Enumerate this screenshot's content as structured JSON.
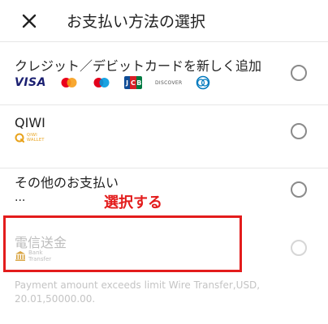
{
  "header": {
    "title": "お支払い方法の選択",
    "close_icon": "close-icon"
  },
  "payment_options": {
    "card": {
      "label": "クレジット／デビットカードを新しく追加",
      "brands": {
        "visa": "VISA",
        "jcb": [
          "J",
          "C",
          "B"
        ],
        "discover": "DISCOVER",
        "icons": [
          "visa-logo",
          "mastercard-logo",
          "maestro-logo",
          "jcb-logo",
          "discover-logo",
          "diners-club-logo"
        ]
      }
    },
    "qiwi": {
      "label": "QIWI",
      "logo_text_1": "QIWI",
      "logo_text_2": "WALLET"
    },
    "other": {
      "label": "その他のお支払い",
      "dots": "..."
    },
    "wire": {
      "label": "電信送金",
      "logo_text_1": "Bank",
      "logo_text_2": "Transfer"
    }
  },
  "annotation": {
    "callout": "選択する"
  },
  "limit_message": "Payment amount exceeds limit Wire Transfer,USD, 20.01,50000.00.",
  "colors": {
    "accent_red": "#e31c1c",
    "visa_blue": "#1a1f71",
    "qiwi_orange": "#e8a21a",
    "disabled_gray": "#bdbdbd"
  }
}
